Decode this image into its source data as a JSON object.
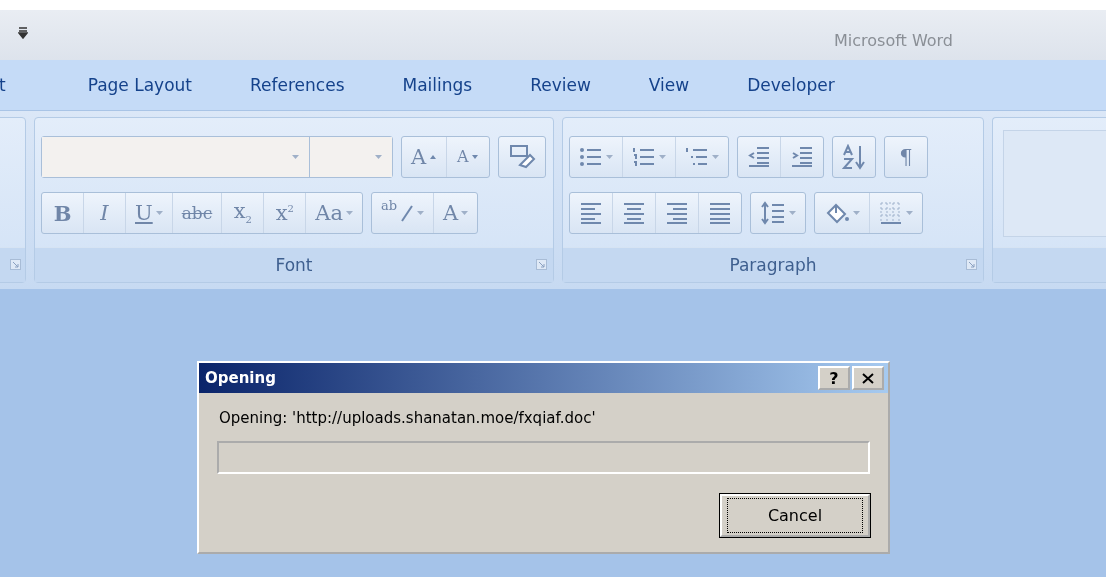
{
  "window": {
    "title": "Microsoft Word"
  },
  "tabs": [
    {
      "label": "t",
      "selected": false
    },
    {
      "label": "Page Layout",
      "selected": false
    },
    {
      "label": "References",
      "selected": false
    },
    {
      "label": "Mailings",
      "selected": false
    },
    {
      "label": "Review",
      "selected": false
    },
    {
      "label": "View",
      "selected": false
    },
    {
      "label": "Developer",
      "selected": false
    }
  ],
  "ribbon": {
    "groups": [
      {
        "kind": "stub",
        "launcher": true
      },
      {
        "kind": "group",
        "label": "Font",
        "launcher": true,
        "rows": [
          [
            [
              {
                "kind": "fontbox"
              },
              {
                "kind": "sizebox"
              }
            ],
            [
              {
                "kind": "grow",
                "text": "A"
              },
              {
                "kind": "shrink",
                "text": "A"
              }
            ],
            [
              {
                "kind": "clear"
              }
            ]
          ],
          [
            [
              {
                "kind": "bold",
                "text": "B"
              },
              {
                "kind": "italic",
                "text": "I"
              },
              {
                "kind": "underline",
                "text": "U",
                "dropdown": true
              },
              {
                "kind": "strike",
                "text": "abc"
              },
              {
                "kind": "subscript",
                "text": "x$_{2}$"
              },
              {
                "kind": "superscript",
                "text": "x$^{2}$"
              },
              {
                "kind": "case",
                "text": "Aa",
                "dropdown": true
              }
            ],
            [
              {
                "kind": "highlight",
                "text": "ab",
                "dropdown": true
              },
              {
                "kind": "color",
                "text": "A",
                "dropdown": true
              }
            ]
          ]
        ]
      },
      {
        "kind": "group",
        "label": "Paragraph",
        "launcher": true,
        "rows": [
          [
            [
              {
                "kind": "bullets",
                "dropdown": true
              },
              {
                "kind": "numbering",
                "dropdown": true
              },
              {
                "kind": "multilevel",
                "dropdown": true
              }
            ],
            [
              {
                "kind": "outdent"
              },
              {
                "kind": "indent"
              }
            ],
            [
              {
                "kind": "sort"
              }
            ],
            [
              {
                "kind": "marks",
                "text": "¶"
              }
            ]
          ],
          [
            [
              {
                "kind": "alignleft"
              },
              {
                "kind": "aligncenter"
              },
              {
                "kind": "alignright"
              },
              {
                "kind": "justify"
              }
            ],
            [
              {
                "kind": "spacing",
                "dropdown": true
              }
            ],
            [
              {
                "kind": "shading",
                "dropdown": true
              },
              {
                "kind": "borders",
                "dropdown": true
              }
            ]
          ]
        ]
      },
      {
        "kind": "empty"
      }
    ]
  },
  "dialog": {
    "title": "Opening",
    "help": "?",
    "message": "Opening: 'http://uploads.shanatan.moe/fxqiaf.doc'",
    "progress": {
      "level": 0
    },
    "buttons": [
      {
        "label": "Cancel",
        "focused": true
      }
    ]
  }
}
